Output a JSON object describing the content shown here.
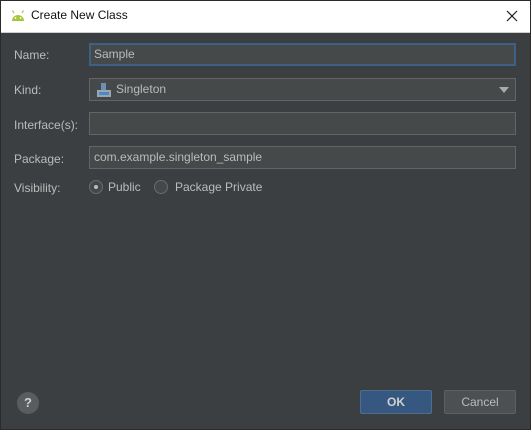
{
  "window": {
    "title": "Create New Class"
  },
  "form": {
    "name_label": "Name:",
    "name_value": "Sample",
    "kind_label": "Kind:",
    "kind_value": "Singleton",
    "interfaces_label": "Interface(s):",
    "interfaces_value": "",
    "package_label": "Package:",
    "package_value": "com.example.singleton_sample",
    "visibility_label": "Visibility:",
    "visibility_options": [
      {
        "label": "Public",
        "selected": true
      },
      {
        "label": "Package Private",
        "selected": false
      }
    ]
  },
  "footer": {
    "help_symbol": "?",
    "ok_label": "OK",
    "cancel_label": "Cancel"
  },
  "colors": {
    "background": "#3c3f41",
    "field_background": "#45494a",
    "focus_border": "#3d6185",
    "primary_button": "#365880",
    "android_green": "#a4c639"
  }
}
